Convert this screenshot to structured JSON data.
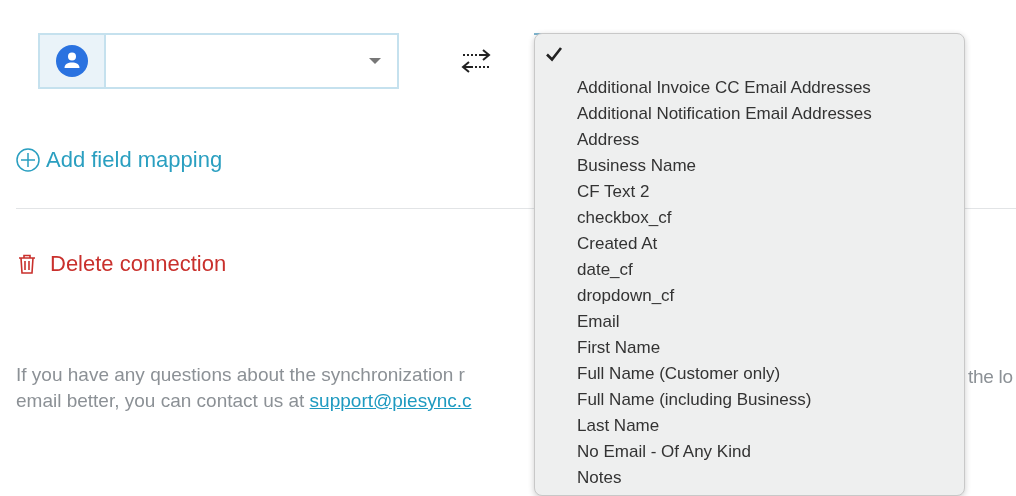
{
  "dropdown_menu": {
    "items": [
      {
        "selected": true
      },
      {
        "label": "Additional Invoice CC Email Addresses",
        "selected": false
      },
      {
        "label": "Additional Notification Email Addresses",
        "selected": false
      },
      {
        "label": "Address",
        "selected": false
      },
      {
        "label": "Business Name",
        "selected": false
      },
      {
        "label": "CF Text 2",
        "selected": false
      },
      {
        "label": "checkbox_cf",
        "selected": false
      },
      {
        "label": "Created At",
        "selected": false
      },
      {
        "label": "date_cf",
        "selected": false
      },
      {
        "label": "dropdown_cf",
        "selected": false
      },
      {
        "label": "Email",
        "selected": false
      },
      {
        "label": "First Name",
        "selected": false
      },
      {
        "label": "Full Name (Customer only)",
        "selected": false
      },
      {
        "label": "Full Name (including Business)",
        "selected": false
      },
      {
        "label": "Last Name",
        "selected": false
      },
      {
        "label": "No Email - Of Any Kind",
        "selected": false
      },
      {
        "label": "Notes",
        "selected": false
      }
    ]
  },
  "add_field_mapping": {
    "label": "Add field mapping"
  },
  "delete_connection": {
    "label": "Delete connection"
  },
  "help_text": {
    "line_1_start": "If you have any questions about the synchronization r",
    "line_1_end": "the lo",
    "line_2": "email better, you can contact us at ",
    "link": "support@piesync.c"
  }
}
